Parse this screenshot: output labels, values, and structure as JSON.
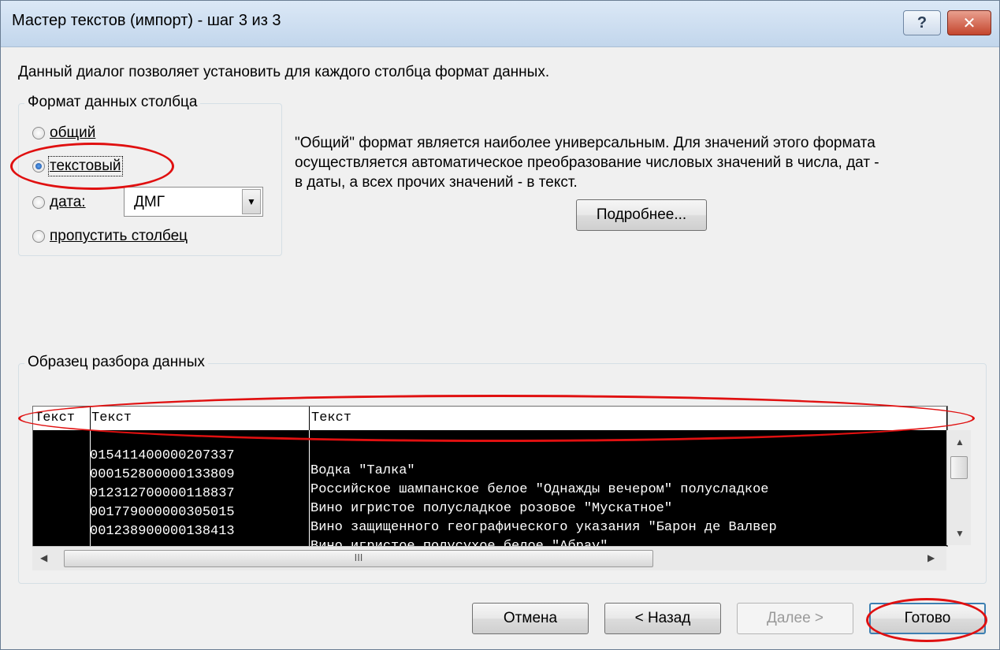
{
  "window": {
    "title": "Мастер текстов (импорт) - шаг 3 из 3",
    "help_glyph": "?",
    "close_glyph": "✕"
  },
  "description": "Данный диалог позволяет установить для каждого столбца формат данных.",
  "format_group": {
    "label": "Формат данных столбца",
    "options": [
      {
        "label": "общий",
        "checked": false
      },
      {
        "label": "текстовый",
        "checked": true
      },
      {
        "label": "дата:",
        "checked": false
      },
      {
        "label": "пропустить столбец",
        "checked": false
      }
    ],
    "date_combo": {
      "value": "ДМГ",
      "arrow": "▼"
    }
  },
  "info": {
    "lines": [
      "\"Общий\" формат является наиболее универсальным. Для значений этого формата",
      "осуществляется автоматическое преобразование числовых значений в числа, дат -",
      "в даты, а всех прочих значений - в текст."
    ],
    "more_button": "Подробнее..."
  },
  "preview_group": {
    "label": "Образец разбора данных",
    "headers": [
      "Текст",
      "Текст",
      "Текст"
    ],
    "rows": [
      [
        "",
        "015411400000207337",
        "Водка \"Талка\""
      ],
      [
        "",
        "000152800000133809",
        "Российское шампанское белое \"Однажды вечером\" полусладкое"
      ],
      [
        "",
        "012312700000118837",
        "Вино игристое полусладкое розовое \"Мускатное\""
      ],
      [
        "",
        "001779000000305015",
        "Вино защищенного географического указания \"Барон де Валвер"
      ],
      [
        "",
        "001238900000138413",
        "Вино игристое полусухое белое \"Абрау\""
      ]
    ],
    "scroll_up": "▲",
    "scroll_down": "▼",
    "scroll_left": "◀",
    "scroll_right": "▶",
    "thumb_grip": "III"
  },
  "buttons": {
    "cancel": "Отмена",
    "back": "< Назад",
    "next": "Далее >",
    "finish": "Готово"
  },
  "colors": {
    "annotation": "#e01010",
    "title_bar": "#c2d6ec",
    "preview_bg": "#000000"
  }
}
